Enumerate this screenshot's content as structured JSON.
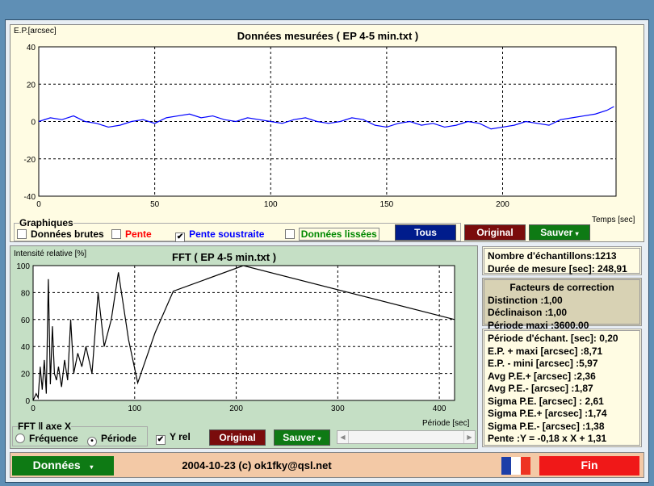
{
  "top_chart": {
    "y_label": "E.P.[arcsec]",
    "title": "Données mesurées ( EP 4-5 min.txt )",
    "x_label": "Temps [sec]"
  },
  "graphiques": {
    "legend": "Graphiques",
    "items": [
      {
        "label": "Données brutes",
        "checked": false,
        "color": "#000000"
      },
      {
        "label": "Pente",
        "checked": false,
        "color": "#ff0000"
      },
      {
        "label": "Pente soustraite",
        "checked": true,
        "color": "#0000ff"
      },
      {
        "label": "Données lissées",
        "checked": false,
        "color": "#008000"
      }
    ]
  },
  "top_buttons": {
    "tous": "Tous",
    "original": "Original",
    "sauver": "Sauver"
  },
  "fft_chart": {
    "y_label": "Intensité relative [%]",
    "title": "FFT ( EP 4-5 min.txt )",
    "x_label": "Période [sec]"
  },
  "fft_axis": {
    "legend": "FFT ‖ axe X",
    "frequence": "Fréquence",
    "periode": "Période",
    "selected": "periode"
  },
  "y_rel": {
    "label": "Y rel",
    "checked": true
  },
  "fft_buttons": {
    "original": "Original",
    "sauver": "Sauver"
  },
  "info1": {
    "samples": "Nombre d'échantillons:1213",
    "duration": "Durée de mesure [sec]: 248,91"
  },
  "corrections": {
    "title": "Facteurs de correction",
    "lines": [
      "Distinction :1,00",
      "Déclinaison :1,00",
      "Période maxi :3600,00"
    ]
  },
  "stats": [
    "Période d'échant. [sec]: 0,20",
    "E.P. + maxi [arcsec] :8,71",
    "E.P. - mini [arcsec] :5,97",
    "Avg P.E.+ [arcsec] :2,36",
    "Avg P.E.- [arcsec] :1,87",
    "Sigma P.E. [arcsec] : 2,61",
    "Sigma P.E.+ [arcsec] :1,74",
    "Sigma P.E.- [arcsec] :1,38",
    "Pente :Y = -0,18 x X + 1,31"
  ],
  "footer": {
    "donnees": "Données",
    "credit": "2004-10-23 (c) ok1fky@qsl.net",
    "fin": "Fin"
  },
  "chart_data": [
    {
      "type": "line",
      "title": "Données mesurées ( EP 4-5 min.txt )",
      "xlabel": "Temps [sec]",
      "ylabel": "E.P.[arcsec]",
      "xlim": [
        0,
        248.91
      ],
      "ylim": [
        -40,
        40
      ],
      "xticks": [
        0,
        50,
        100,
        150,
        200
      ],
      "yticks": [
        -40,
        -20,
        0,
        20,
        40
      ],
      "grid": true,
      "color": "#0000ff",
      "x": [
        0,
        5,
        10,
        15,
        20,
        25,
        30,
        35,
        40,
        45,
        50,
        55,
        60,
        65,
        70,
        75,
        80,
        85,
        90,
        95,
        100,
        105,
        110,
        115,
        120,
        125,
        130,
        135,
        140,
        145,
        150,
        155,
        160,
        165,
        170,
        175,
        180,
        185,
        190,
        195,
        200,
        205,
        210,
        215,
        220,
        225,
        230,
        235,
        240,
        245,
        248
      ],
      "y": [
        0,
        2,
        1,
        3,
        0,
        -1,
        -3,
        -2,
        0,
        1,
        -1,
        2,
        3,
        4,
        2,
        3,
        1,
        0,
        2,
        1,
        0,
        -1,
        1,
        2,
        0,
        -1,
        0,
        2,
        1,
        -2,
        -3,
        -1,
        0,
        -2,
        -1,
        -3,
        -2,
        0,
        -1,
        -4,
        -3,
        -2,
        0,
        -1,
        -2,
        1,
        2,
        3,
        4,
        6,
        8
      ]
    },
    {
      "type": "line",
      "title": "FFT ( EP 4-5 min.txt )",
      "xlabel": "Période [sec]",
      "ylabel": "Intensité relative [%]",
      "xlim": [
        0,
        415
      ],
      "ylim": [
        0,
        100
      ],
      "xticks": [
        0,
        100,
        200,
        300,
        400
      ],
      "yticks": [
        0,
        20,
        40,
        60,
        80,
        100
      ],
      "grid": true,
      "color": "#000000",
      "x": [
        0,
        3,
        5,
        7,
        9,
        11,
        13,
        15,
        17,
        19,
        21,
        23,
        25,
        28,
        31,
        34,
        37,
        40,
        44,
        48,
        52,
        58,
        64,
        70,
        77,
        84,
        94,
        103,
        120,
        138,
        207,
        415
      ],
      "y": [
        0,
        5,
        2,
        25,
        8,
        30,
        5,
        90,
        12,
        55,
        20,
        15,
        25,
        10,
        30,
        15,
        60,
        20,
        35,
        25,
        40,
        20,
        80,
        40,
        60,
        95,
        45,
        13,
        50,
        81,
        100,
        60
      ]
    }
  ]
}
